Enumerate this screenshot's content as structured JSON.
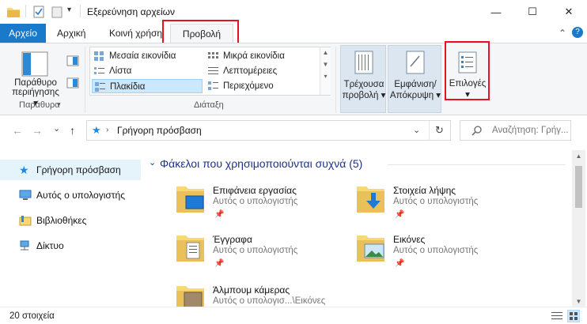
{
  "window": {
    "title": "Εξερεύνηση αρχείων",
    "minimize": "—",
    "maximize": "☐",
    "close": "✕"
  },
  "ribbon_tabs": [
    {
      "label": "Αρχείο"
    },
    {
      "label": "Αρχική"
    },
    {
      "label": "Κοινή χρήση"
    },
    {
      "label": "Προβολή"
    }
  ],
  "collapse_ribbon": "⌃",
  "help": "?",
  "ribbon": {
    "panes": {
      "nav_pane_label_1": "Παράθυρο",
      "nav_pane_label_2": "περιήγησης",
      "group_label": "Παράθυρα"
    },
    "layout": {
      "items": [
        {
          "label": "Μεσαία εικονίδια"
        },
        {
          "label": "Μικρά εικονίδια"
        },
        {
          "label": "Λίστα"
        },
        {
          "label": "Λεπτομέρειες"
        },
        {
          "label": "Πλακίδια"
        },
        {
          "label": "Περιεχόμενο"
        }
      ],
      "group_label": "Διάταξη"
    },
    "current_view": {
      "line1": "Τρέχουσα",
      "line2": "προβολή"
    },
    "show_hide": {
      "line1": "Εμφάνιση/",
      "line2": "Απόκρυψη"
    },
    "options": {
      "label": "Επιλογές"
    }
  },
  "nav": {
    "back": "←",
    "forward": "→",
    "recent": "⌄",
    "up": "↑",
    "address": "Γρήγορη πρόσβαση",
    "search_placeholder": "Αναζήτηση: Γρήγ..."
  },
  "nav_pane": [
    {
      "label": "Γρήγορη πρόσβαση"
    },
    {
      "label": "Αυτός ο υπολογιστής"
    },
    {
      "label": "Βιβλιοθήκες"
    },
    {
      "label": "Δίκτυο"
    }
  ],
  "content": {
    "section_title": "Φάκελοι που χρησιμοποιούνται συχνά (5)",
    "tiles": [
      {
        "name": "Επιφάνεια εργασίας",
        "sub": "Αυτός ο υπολογιστής"
      },
      {
        "name": "Στοιχεία λήψης",
        "sub": "Αυτός ο υπολογιστής"
      },
      {
        "name": "Έγγραφα",
        "sub": "Αυτός ο υπολογιστής"
      },
      {
        "name": "Εικόνες",
        "sub": "Αυτός ο υπολογιστής"
      },
      {
        "name": "Άλμπουμ κάμερας",
        "sub": "Αυτός ο υπολογισ...\\Εικόνες"
      }
    ]
  },
  "status": {
    "items": "20 στοιχεία"
  },
  "colors": {
    "accent": "#1979ca",
    "highlight": "#e81123",
    "selected": "#cce8ff"
  }
}
